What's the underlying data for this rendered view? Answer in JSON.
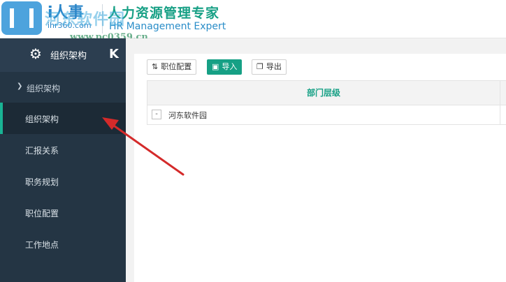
{
  "header": {
    "brand_cn": "i人事",
    "brand_url": "ihr360.com",
    "slogan": "人力资源管理专家",
    "tagline": "HR Management Expert",
    "watermark": "河东软件园",
    "watermark_url": "www.pc0359.cn"
  },
  "sidebar": {
    "title": "组织架构",
    "collapse_glyph": "K",
    "group_label": "组织架构",
    "items": [
      {
        "label": "组织架构",
        "active": true
      },
      {
        "label": "汇报关系"
      },
      {
        "label": "职务规划"
      },
      {
        "label": "职位配置"
      },
      {
        "label": "工作地点"
      }
    ],
    "icons": {
      "gear": "gear-icon",
      "chevron": "chevron-down-icon"
    }
  },
  "toolbar": {
    "position_config_label": "职位配置",
    "import_label": "导入",
    "export_label": "导出"
  },
  "table": {
    "column_header": "部门层级",
    "rows": [
      {
        "toggle": "-",
        "label": "河东软件园"
      }
    ]
  },
  "colors": {
    "sidebar_bg": "#243544",
    "accent": "#16a085",
    "arrow": "#d42a2a"
  }
}
